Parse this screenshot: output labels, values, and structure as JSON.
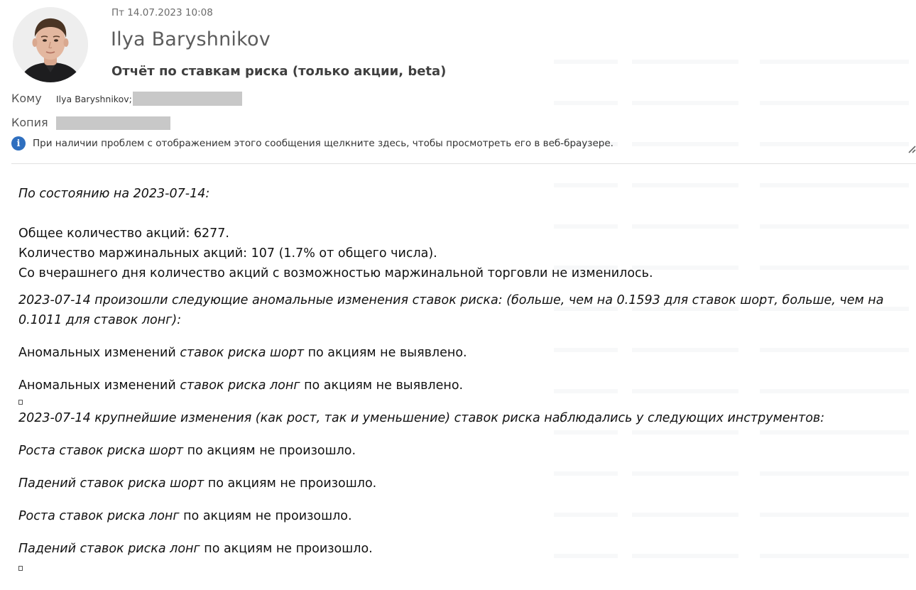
{
  "message": {
    "date": "Пт 14.07.2023 10:08",
    "sender": "Ilya Baryshnikov",
    "subject": "Отчёт по ставкам риска (только акции, beta)",
    "to_label": "Кому",
    "to_value": "Ilya Baryshnikov;",
    "cc_label": "Копия",
    "info_text": "При наличии проблем с отображением этого сообщения щелкните здесь, чтобы просмотреть его в веб-браузере."
  },
  "body": {
    "as_of": "По состоянию на 2023-07-14:",
    "total": "Общее количество акций: 6277.",
    "margin": "Количество маржинальных акций: 107 (1.7% от общего числа).",
    "no_change": "Со вчерашнего дня количество акций с возможностью маржинальной торговли не изменилось.",
    "anomalies_intro": "2023-07-14 произошли следующие аномальные изменения ставок риска: (больше, чем на 0.1593 для ставок шорт, больше, чем на 0.1011 для ставок лонг):",
    "anom_short_a": "Аномальных изменений ",
    "anom_short_b": "ставок риска шорт",
    "anom_short_c": " по акциям не выявлено.",
    "anom_long_a": "Аномальных изменений ",
    "anom_long_b": "ставок риска лонг",
    "anom_long_c": " по акциям не выявлено.",
    "largest_intro": "2023-07-14 крупнейшие изменения (как рост, так и уменьшение) ставок риска наблюдались у следующих инструментов:",
    "rise_short_a": "Роста ставок риска шорт",
    "rise_short_b": " по акциям не произошло.",
    "fall_short_a": "Падений ставок риска шорт",
    "fall_short_b": " по акциям не произошло.",
    "rise_long_a": "Роста ставок риска лонг",
    "rise_long_b": " по акциям не произошло.",
    "fall_long_a": "Падений ставок риска лонг",
    "fall_long_b": " по акциям не произошло."
  },
  "colors": {
    "info_icon": "#2f6fbf",
    "redaction": "#c8c8c8",
    "divider": "#e1e1e1"
  },
  "icons": {
    "info": "info-icon",
    "resize": "resize-handle-icon"
  }
}
